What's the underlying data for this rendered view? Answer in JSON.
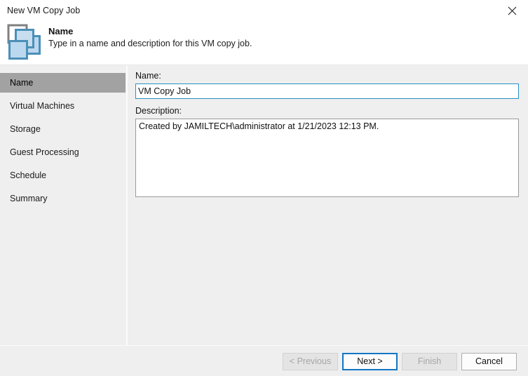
{
  "window": {
    "title": "New VM Copy Job",
    "close_icon": "close-icon"
  },
  "header": {
    "icon": "vm-copy-job-icon",
    "title": "Name",
    "subtitle": "Type in a name and description for this VM copy job."
  },
  "sidebar": {
    "items": [
      {
        "label": "Name",
        "selected": true
      },
      {
        "label": "Virtual Machines",
        "selected": false
      },
      {
        "label": "Storage",
        "selected": false
      },
      {
        "label": "Guest Processing",
        "selected": false
      },
      {
        "label": "Schedule",
        "selected": false
      },
      {
        "label": "Summary",
        "selected": false
      }
    ]
  },
  "form": {
    "name_label": "Name:",
    "name_value": "VM Copy Job",
    "name_placeholder": "",
    "description_label": "Description:",
    "description_value": "Created by JAMILTECH\\administrator at 1/21/2023 12:13 PM.",
    "description_placeholder": ""
  },
  "footer": {
    "previous_label": "< Previous",
    "next_label": "Next >",
    "finish_label": "Finish",
    "cancel_label": "Cancel"
  },
  "colors": {
    "accent": "#1276c4",
    "focus_border": "#2a8fc4",
    "window_bg": "#efefef",
    "selected_nav": "#a2a2a2",
    "icon_blue": "#4a90b8",
    "icon_gray": "#808080"
  }
}
